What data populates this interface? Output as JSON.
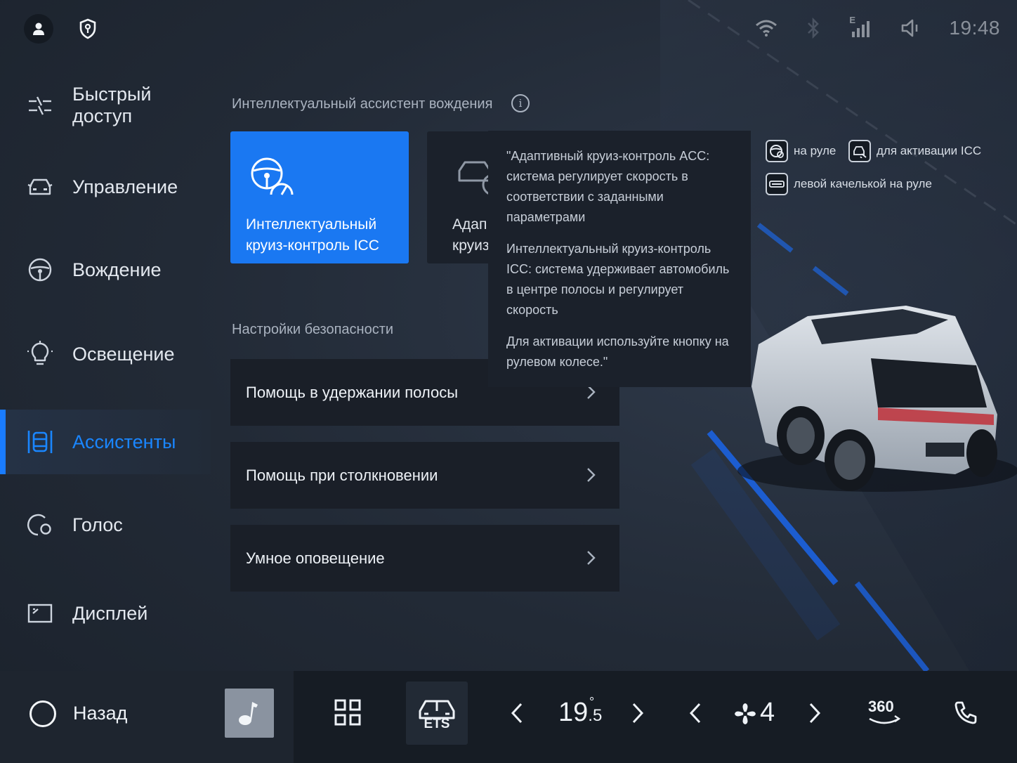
{
  "status_bar": {
    "time": "19:48",
    "icons": [
      "user-icon",
      "shield-key-icon",
      "wifi-icon",
      "bluetooth-icon",
      "signal-e-icon",
      "volume-icon"
    ],
    "signal_label": "E"
  },
  "sidebar": {
    "items": [
      {
        "label": "Быстрый доступ",
        "icon": "quick-access-icon"
      },
      {
        "label": "Управление",
        "icon": "car-control-icon"
      },
      {
        "label": "Вождение",
        "icon": "steering-wheel-icon"
      },
      {
        "label": "Освещение",
        "icon": "light-bulb-icon"
      },
      {
        "label": "Ассистенты",
        "icon": "assistant-icon",
        "active": true
      },
      {
        "label": "Голос",
        "icon": "voice-icon"
      },
      {
        "label": "Дисплей",
        "icon": "display-icon"
      }
    ]
  },
  "main": {
    "assistant_section_title": "Интеллектуальный ассистент вождения",
    "info_symbol": "i",
    "modes": [
      {
        "label_line1": "Интеллектуальный",
        "label_line2": "круиз-контроль ICC",
        "selected": true
      },
      {
        "label_line1": "Адап",
        "label_line2": "круиз",
        "selected": false
      }
    ],
    "safety_section_title": "Настройки безопасности",
    "safety_rows": [
      {
        "label": "Помощь в удержании полосы"
      },
      {
        "label": "Помощь при столкновении"
      },
      {
        "label": "Умное оповещение"
      }
    ]
  },
  "tooltip": {
    "paragraphs": [
      "\"Адаптивный круиз-контроль ACC: система регулирует скорость в соответствии с заданными параметрами",
      "Интеллектуальный круиз-контроль ICC: система удерживает автомобиль в центре полосы и регулирует скорость",
      "Для активации используйте кнопку на рулевом колесе.\""
    ]
  },
  "hints": {
    "on_wheel": "на руле",
    "to_activate_icc": "для активации ICC",
    "left_rocker": "левой качелькой на руле"
  },
  "dock": {
    "back_label": "Назад",
    "temperature_main": "19",
    "temperature_decimal": ".5",
    "temperature_unit": "°",
    "fan_speed": "4",
    "ets_label": "ETS",
    "camera_label": "360"
  },
  "colors": {
    "accent": "#1a7cff",
    "card_selected": "#1a78f2",
    "background": "#222a36",
    "panel": "#1a1f28"
  }
}
